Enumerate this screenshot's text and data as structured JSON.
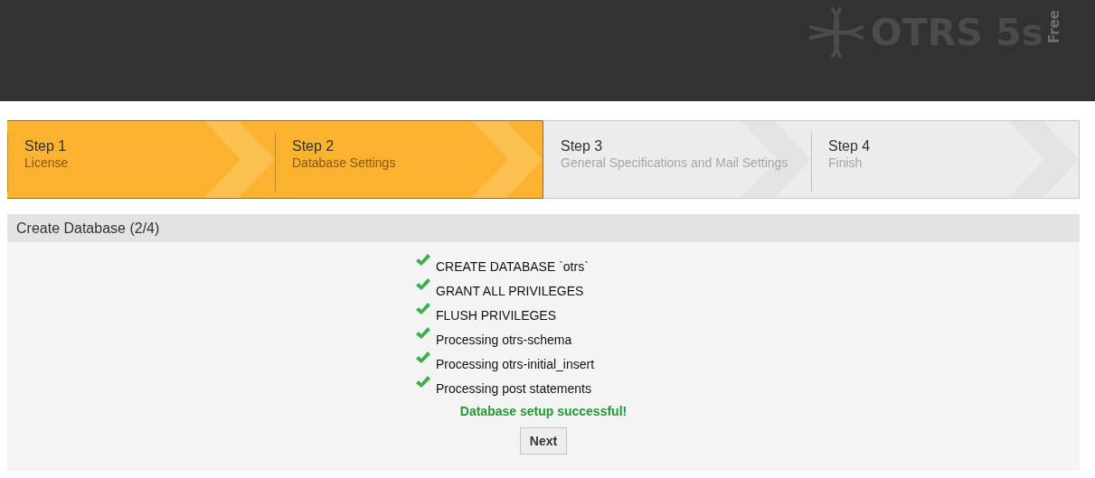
{
  "header": {
    "logo_text": "OTRS 5s",
    "edition": "Free"
  },
  "steps": [
    {
      "title": "Step 1",
      "subtitle": "License",
      "done": true
    },
    {
      "title": "Step 2",
      "subtitle": "Database Settings",
      "done": true
    },
    {
      "title": "Step 3",
      "subtitle": "General Specifications and Mail Settings",
      "done": false
    },
    {
      "title": "Step 4",
      "subtitle": "Finish",
      "done": false
    }
  ],
  "panel": {
    "title": "Create Database (2/4)",
    "results": [
      {
        "text": "CREATE DATABASE `otrs`",
        "ok": true
      },
      {
        "text": "GRANT ALL PRIVILEGES",
        "ok": true
      },
      {
        "text": "FLUSH PRIVILEGES",
        "ok": true
      },
      {
        "text": "Processing otrs-schema",
        "ok": true
      },
      {
        "text": "Processing otrs-initial_insert",
        "ok": true
      },
      {
        "text": "Processing post statements",
        "ok": true
      }
    ],
    "message": "Database setup successful!",
    "button": "Next"
  }
}
